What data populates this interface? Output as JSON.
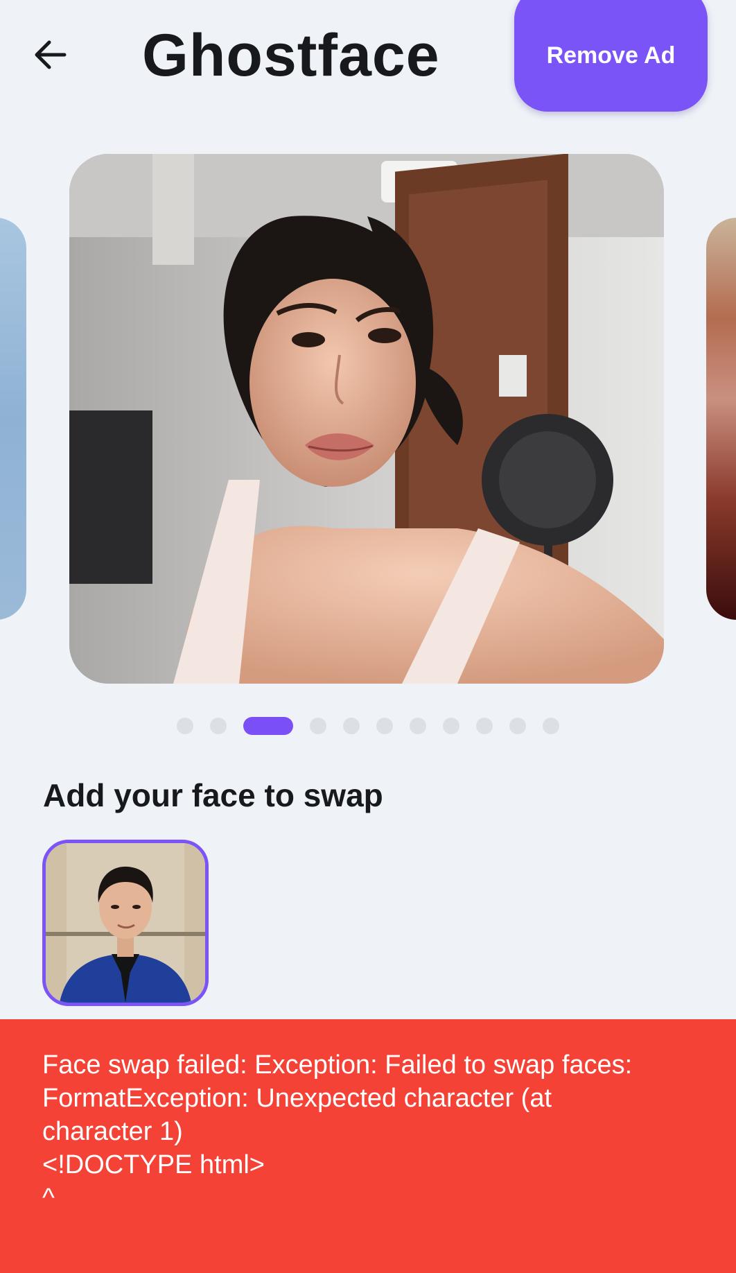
{
  "header": {
    "title": "Ghostface",
    "remove_ad_label": "Remove Ad",
    "back_icon": "arrow-left-icon"
  },
  "carousel": {
    "active_index": 2,
    "dot_count": 11
  },
  "face_section": {
    "title": "Add your face to swap"
  },
  "error": {
    "message": "Face swap failed: Exception: Failed to swap faces:\nFormatException: Unexpected character (at\ncharacter 1)\n<!DOCTYPE html>\n^"
  },
  "colors": {
    "accent": "#7b54f8",
    "error": "#f44336",
    "background": "#eff3f8"
  }
}
